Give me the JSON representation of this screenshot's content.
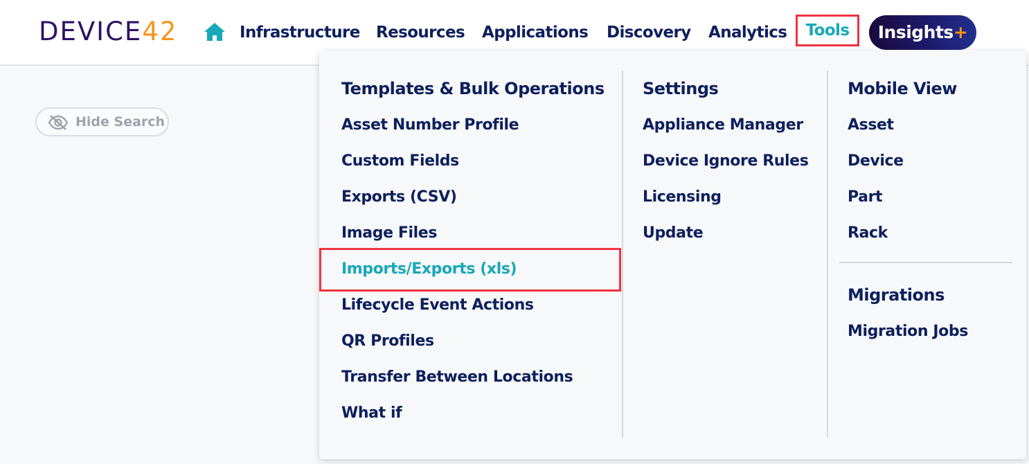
{
  "logo": {
    "word": "DEVICE",
    "number": "42"
  },
  "nav": {
    "home_icon": "home-icon",
    "items": [
      "Infrastructure",
      "Resources",
      "Applications",
      "Discovery",
      "Analytics"
    ],
    "tools": "Tools",
    "insights": {
      "label": "Insights",
      "plus": "+"
    }
  },
  "hide_search": {
    "label": "Hide Search",
    "icon": "eye-off-icon"
  },
  "menu": {
    "col1": {
      "header": "Templates & Bulk Operations",
      "links": [
        "Asset Number Profile",
        "Custom Fields",
        "Exports (CSV)",
        "Image Files",
        "Imports/Exports (xls)",
        "Lifecycle Event Actions",
        "QR Profiles",
        "Transfer Between Locations",
        "What if"
      ]
    },
    "col2": {
      "header": "Settings",
      "links": [
        "Appliance Manager",
        "Device Ignore Rules",
        "Licensing",
        "Update"
      ]
    },
    "col3": {
      "header": "Mobile View",
      "links": [
        "Asset",
        "Device",
        "Part",
        "Rack"
      ],
      "header2": "Migrations",
      "links2": [
        "Migration Jobs"
      ]
    }
  },
  "colors": {
    "navy": "#0d1f5c",
    "teal": "#17a9b8",
    "highlight": "#ef3340",
    "logo_purple": "#2e1065",
    "logo_orange": "#f7931e"
  }
}
